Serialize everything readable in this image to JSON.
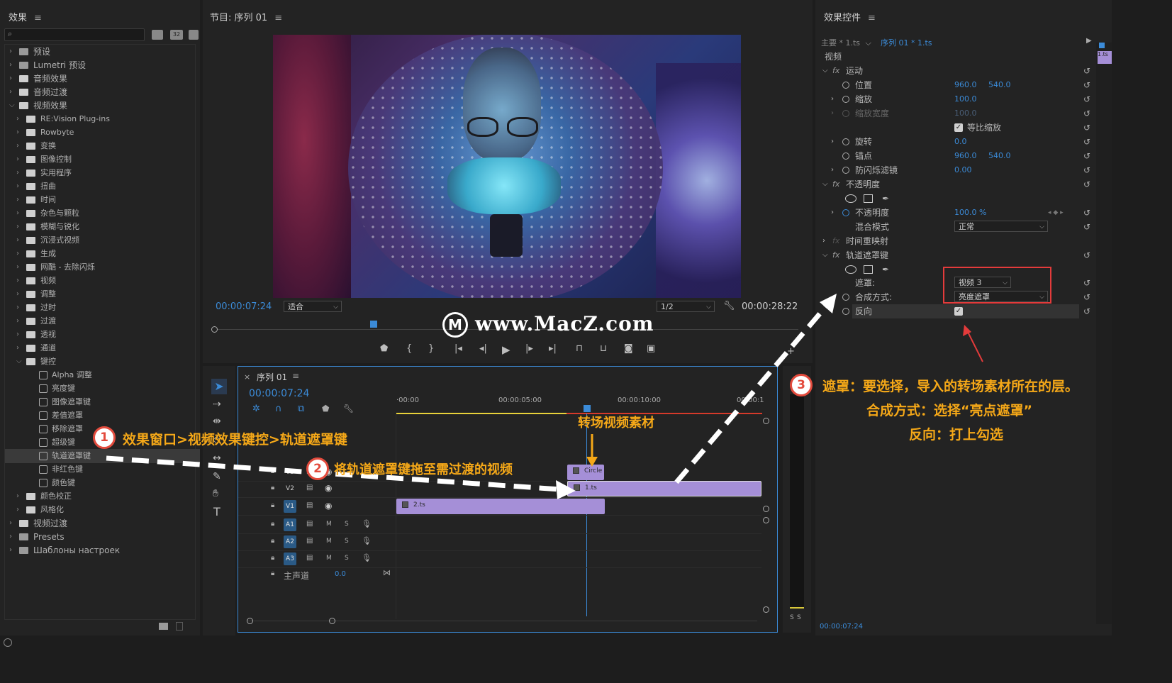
{
  "effects_panel": {
    "title": "效果",
    "search_placeholder": "",
    "toolbar": [
      "32",
      "YUV"
    ],
    "items": [
      {
        "label": "预设",
        "level": 0,
        "open": false,
        "kind": "bin"
      },
      {
        "label": "Lumetri 预设",
        "level": 0,
        "open": false,
        "kind": "bin"
      },
      {
        "label": "音频效果",
        "level": 0,
        "open": false,
        "kind": "folder"
      },
      {
        "label": "音频过渡",
        "level": 0,
        "open": false,
        "kind": "folder"
      },
      {
        "label": "视频效果",
        "level": 0,
        "open": true,
        "kind": "folder"
      },
      {
        "label": "RE:Vision Plug-ins",
        "level": 1,
        "open": false,
        "kind": "folder"
      },
      {
        "label": "Rowbyte",
        "level": 1,
        "open": false,
        "kind": "folder"
      },
      {
        "label": "变换",
        "level": 1,
        "open": false,
        "kind": "folder"
      },
      {
        "label": "图像控制",
        "level": 1,
        "open": false,
        "kind": "folder"
      },
      {
        "label": "实用程序",
        "level": 1,
        "open": false,
        "kind": "folder"
      },
      {
        "label": "扭曲",
        "level": 1,
        "open": false,
        "kind": "folder"
      },
      {
        "label": "时间",
        "level": 1,
        "open": false,
        "kind": "folder"
      },
      {
        "label": "杂色与颗粒",
        "level": 1,
        "open": false,
        "kind": "folder"
      },
      {
        "label": "模糊与锐化",
        "level": 1,
        "open": false,
        "kind": "folder"
      },
      {
        "label": "沉浸式视频",
        "level": 1,
        "open": false,
        "kind": "folder"
      },
      {
        "label": "生成",
        "level": 1,
        "open": false,
        "kind": "folder"
      },
      {
        "label": "网酷 - 去除闪烁",
        "level": 1,
        "open": false,
        "kind": "folder"
      },
      {
        "label": "视频",
        "level": 1,
        "open": false,
        "kind": "folder"
      },
      {
        "label": "调整",
        "level": 1,
        "open": false,
        "kind": "folder"
      },
      {
        "label": "过时",
        "level": 1,
        "open": false,
        "kind": "folder"
      },
      {
        "label": "过渡",
        "level": 1,
        "open": false,
        "kind": "folder"
      },
      {
        "label": "透视",
        "level": 1,
        "open": false,
        "kind": "folder"
      },
      {
        "label": "通道",
        "level": 1,
        "open": false,
        "kind": "folder"
      },
      {
        "label": "键控",
        "level": 1,
        "open": true,
        "kind": "folder"
      },
      {
        "label": "Alpha 调整",
        "level": 2,
        "kind": "fx"
      },
      {
        "label": "亮度键",
        "level": 2,
        "kind": "fx"
      },
      {
        "label": "图像遮罩键",
        "level": 2,
        "kind": "fx"
      },
      {
        "label": "差值遮罩",
        "level": 2,
        "kind": "fx"
      },
      {
        "label": "移除遮罩",
        "level": 2,
        "kind": "fx"
      },
      {
        "label": "超级键",
        "level": 2,
        "kind": "fx"
      },
      {
        "label": "轨道遮罩键",
        "level": 2,
        "kind": "fx",
        "selected": true
      },
      {
        "label": "非红色键",
        "level": 2,
        "kind": "fx"
      },
      {
        "label": "颜色键",
        "level": 2,
        "kind": "fx"
      },
      {
        "label": "颜色校正",
        "level": 1,
        "open": false,
        "kind": "folder"
      },
      {
        "label": "风格化",
        "level": 1,
        "open": false,
        "kind": "folder"
      },
      {
        "label": "视频过渡",
        "level": 0,
        "open": false,
        "kind": "folder"
      },
      {
        "label": "Presets",
        "level": 0,
        "open": false,
        "kind": "bin"
      },
      {
        "label": "Шаблоны настроек",
        "level": 0,
        "open": false,
        "kind": "bin"
      }
    ]
  },
  "program_monitor": {
    "title": "节目: 序列 01",
    "timecode": "00:00:07:24",
    "fit": "适合",
    "resolution": "1/2",
    "duration": "00:00:28:22",
    "playhead_fraction": 0.27
  },
  "effect_controls": {
    "title": "效果控件",
    "master": "主要 * 1.ts",
    "sequence": "序列 01 * 1.ts",
    "clip_tag": "1.ts",
    "section": "视频",
    "motion": "运动",
    "position_label": "位置",
    "position_x": "960.0",
    "position_y": "540.0",
    "scale_label": "缩放",
    "scale": "100.0",
    "scale_width_label": "缩放宽度",
    "scale_width": "100.0",
    "uniform_label": "等比缩放",
    "rotation_label": "旋转",
    "rotation": "0.0",
    "anchor_label": "锚点",
    "anchor_x": "960.0",
    "anchor_y": "540.0",
    "flicker_label": "防闪烁滤镜",
    "flicker": "0.00",
    "opacity_section": "不透明度",
    "opacity_label": "不透明度",
    "opacity": "100.0 %",
    "blend_label": "混合模式",
    "blend": "正常",
    "time_remap": "时间重映射",
    "track_matte": "轨道遮罩键",
    "matte_label": "遮罩:",
    "matte": "视频 3",
    "composite_label": "合成方式:",
    "composite": "亮度遮罩",
    "reverse_label": "反向",
    "footer_time": "00:00:07:24"
  },
  "timeline": {
    "title": "序列 01",
    "timecode": "00:00:07:24",
    "ruler": [
      "·00:00",
      "00:00:05:00",
      "00:00:10:00",
      "00:00:1"
    ],
    "tracks": [
      {
        "name": "V3",
        "target": false
      },
      {
        "name": "V2",
        "target": false
      },
      {
        "name": "V1",
        "target": true
      },
      {
        "name": "A1",
        "target": true
      },
      {
        "name": "A2",
        "target": true
      },
      {
        "name": "A3",
        "target": true
      }
    ],
    "master_label": "主声道",
    "master_value": "0.0",
    "clip_circle": "Circle",
    "clip_1": "1.ts",
    "clip_2": "2.ts",
    "m_label": "M",
    "s_label": "S"
  },
  "watermark": "www.MacZ.com",
  "annotations": {
    "step1": "效果窗口>视频效果键控>轨道遮罩键",
    "step2": "将轨道遮罩键拖至需过渡的视频",
    "step3_line1": "遮罩：要选择，导入的转场素材所在的层。",
    "step3_line2": "合成方式：选择“亮点遮罩”",
    "step3_line3": "反向：打上勾选",
    "transition_label": "转场视频素材",
    "badge1": "1",
    "badge2": "2",
    "badge3": "3"
  },
  "colors": {
    "accent": "#3b8bd8",
    "annotation": "#f5a818",
    "badge_ring": "#e34b3d",
    "clip": "#a58fd7",
    "highlight_box": "#e33b3b"
  }
}
